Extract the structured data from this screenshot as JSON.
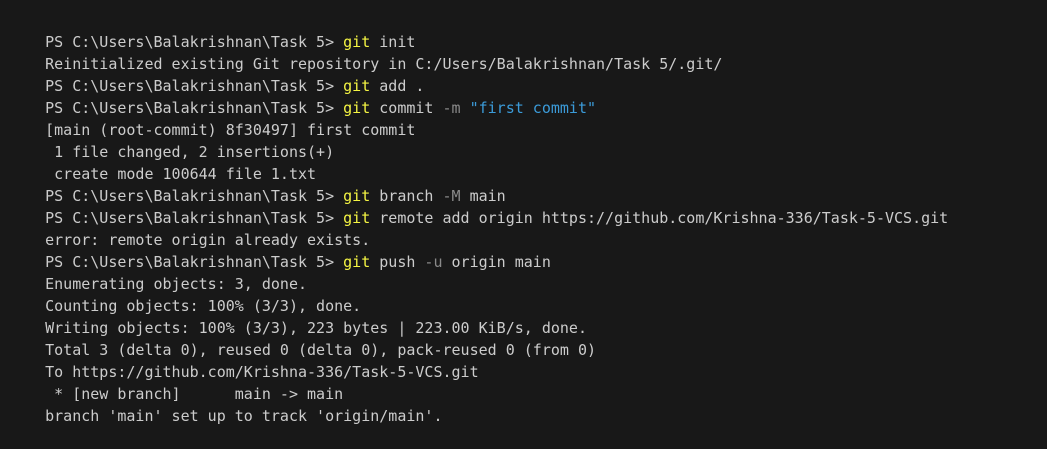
{
  "terminal": {
    "lines": [
      {
        "prompt": "PS C:\\Users\\Balakrishnan\\Task 5> ",
        "cmd": "git",
        "rest": " init"
      },
      {
        "out": "Reinitialized existing Git repository in C:/Users/Balakrishnan/Task 5/.git/"
      },
      {
        "prompt": "PS C:\\Users\\Balakrishnan\\Task 5> ",
        "cmd": "git",
        "rest": " add ."
      },
      {
        "prompt": "PS C:\\Users\\Balakrishnan\\Task 5> ",
        "cmd": "git",
        "rest": " commit ",
        "flag": "-m",
        "str": " \"first commit\""
      },
      {
        "out": "[main (root-commit) 8f30497] first commit"
      },
      {
        "out": " 1 file changed, 2 insertions(+)"
      },
      {
        "out": " create mode 100644 file 1.txt"
      },
      {
        "prompt": "PS C:\\Users\\Balakrishnan\\Task 5> ",
        "cmd": "git",
        "rest": " branch ",
        "flag": "-M",
        "rest2": " main"
      },
      {
        "prompt": "PS C:\\Users\\Balakrishnan\\Task 5> ",
        "cmd": "git",
        "rest": " remote add origin https://github.com/Krishna-336/Task-5-VCS.git"
      },
      {
        "out": "error: remote origin already exists."
      },
      {
        "prompt": "PS C:\\Users\\Balakrishnan\\Task 5> ",
        "cmd": "git",
        "rest": " push ",
        "flag": "-u",
        "rest2": " origin main"
      },
      {
        "out": "Enumerating objects: 3, done."
      },
      {
        "out": "Counting objects: 100% (3/3), done."
      },
      {
        "out": "Writing objects: 100% (3/3), 223 bytes | 223.00 KiB/s, done."
      },
      {
        "out": "Total 3 (delta 0), reused 0 (delta 0), pack-reused 0 (from 0)"
      },
      {
        "out": "To https://github.com/Krishna-336/Task-5-VCS.git"
      },
      {
        "out": " * [new branch]      main -> main"
      },
      {
        "out": "branch 'main' set up to track 'origin/main'."
      }
    ]
  },
  "colors": {
    "background": "#181818",
    "text": "#cccccc",
    "command": "#f5f543",
    "flag": "#8a8a8a",
    "string": "#3b9bd9"
  }
}
